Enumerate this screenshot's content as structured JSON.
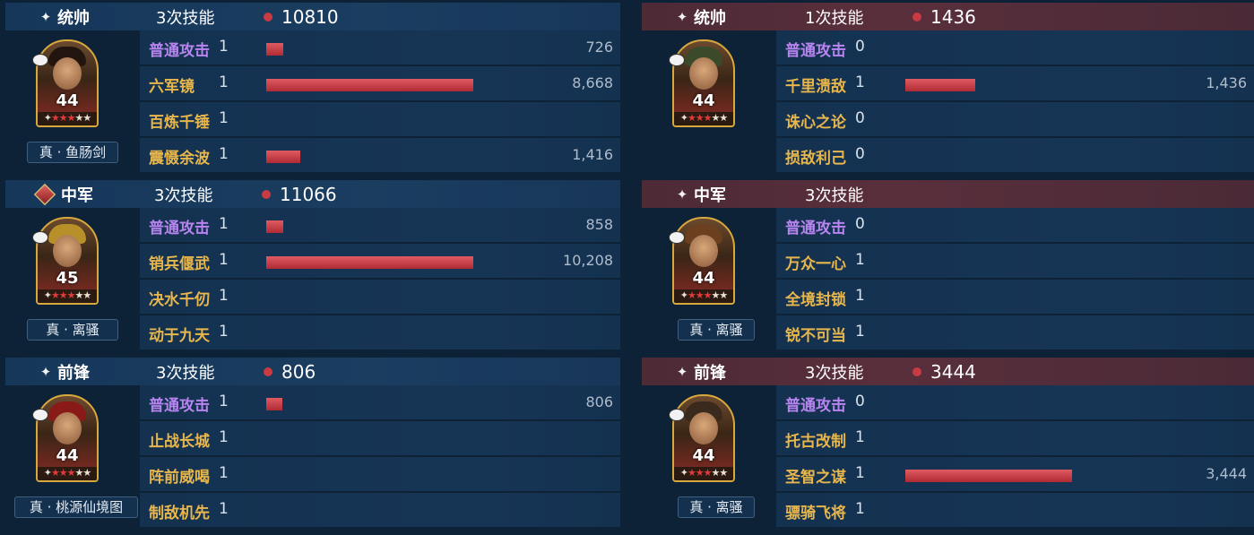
{
  "star_glyph": "✦",
  "left": [
    {
      "role": "统帅",
      "casts": "3次技能",
      "damage": "10810",
      "level": "44",
      "gear": "真 · 鱼肠剑",
      "skills": [
        {
          "name": "普通攻击",
          "count": "1",
          "value": "726",
          "ratio": 0.084,
          "normal": true
        },
        {
          "name": "六军镜",
          "count": "1",
          "value": "8,668",
          "ratio": 1.0
        },
        {
          "name": "百炼千锤",
          "count": "1",
          "value": "",
          "ratio": 0
        },
        {
          "name": "震慑余波",
          "count": "1",
          "value": "1,416",
          "ratio": 0.163
        }
      ]
    },
    {
      "role": "中军",
      "casts": "3次技能",
      "damage": "11066",
      "level": "45",
      "gear": "真 · 离骚",
      "skills": [
        {
          "name": "普通攻击",
          "count": "1",
          "value": "858",
          "ratio": 0.084,
          "normal": true
        },
        {
          "name": "销兵偃武",
          "count": "1",
          "value": "10,208",
          "ratio": 1.0
        },
        {
          "name": "决水千仞",
          "count": "1",
          "value": "",
          "ratio": 0
        },
        {
          "name": "动于九天",
          "count": "1",
          "value": "",
          "ratio": 0
        }
      ]
    },
    {
      "role": "前锋",
      "casts": "3次技能",
      "damage": "806",
      "level": "44",
      "gear": "真 · 桃源仙境图",
      "skills": [
        {
          "name": "普通攻击",
          "count": "1",
          "value": "806",
          "ratio": 0.079,
          "normal": true
        },
        {
          "name": "止战长城",
          "count": "1",
          "value": "",
          "ratio": 0
        },
        {
          "name": "阵前威喝",
          "count": "1",
          "value": "",
          "ratio": 0
        },
        {
          "name": "制敌机先",
          "count": "1",
          "value": "",
          "ratio": 0
        }
      ]
    }
  ],
  "right": [
    {
      "role": "统帅",
      "casts": "1次技能",
      "damage": "1436",
      "level": "44",
      "gear": "",
      "skills": [
        {
          "name": "普通攻击",
          "count": "0",
          "value": "",
          "ratio": 0,
          "normal": true
        },
        {
          "name": "千里溃敌",
          "count": "1",
          "value": "1,436",
          "ratio": 0.42
        },
        {
          "name": "诛心之论",
          "count": "0",
          "value": "",
          "ratio": 0
        },
        {
          "name": "损敌利己",
          "count": "0",
          "value": "",
          "ratio": 0
        }
      ]
    },
    {
      "role": "中军",
      "casts": "3次技能",
      "damage": "",
      "level": "44",
      "gear": "真 · 离骚",
      "skills": [
        {
          "name": "普通攻击",
          "count": "0",
          "value": "",
          "ratio": 0,
          "normal": true
        },
        {
          "name": "万众一心",
          "count": "1",
          "value": "",
          "ratio": 0
        },
        {
          "name": "全境封锁",
          "count": "1",
          "value": "",
          "ratio": 0
        },
        {
          "name": "锐不可当",
          "count": "1",
          "value": "",
          "ratio": 0
        }
      ]
    },
    {
      "role": "前锋",
      "casts": "3次技能",
      "damage": "3444",
      "level": "44",
      "gear": "真 · 离骚",
      "skills": [
        {
          "name": "普通攻击",
          "count": "0",
          "value": "",
          "ratio": 0,
          "normal": true
        },
        {
          "name": "托古改制",
          "count": "1",
          "value": "",
          "ratio": 0
        },
        {
          "name": "圣智之谋",
          "count": "1",
          "value": "3,444",
          "ratio": 1.0
        },
        {
          "name": "骠骑飞将",
          "count": "1",
          "value": "",
          "ratio": 0
        }
      ]
    }
  ]
}
